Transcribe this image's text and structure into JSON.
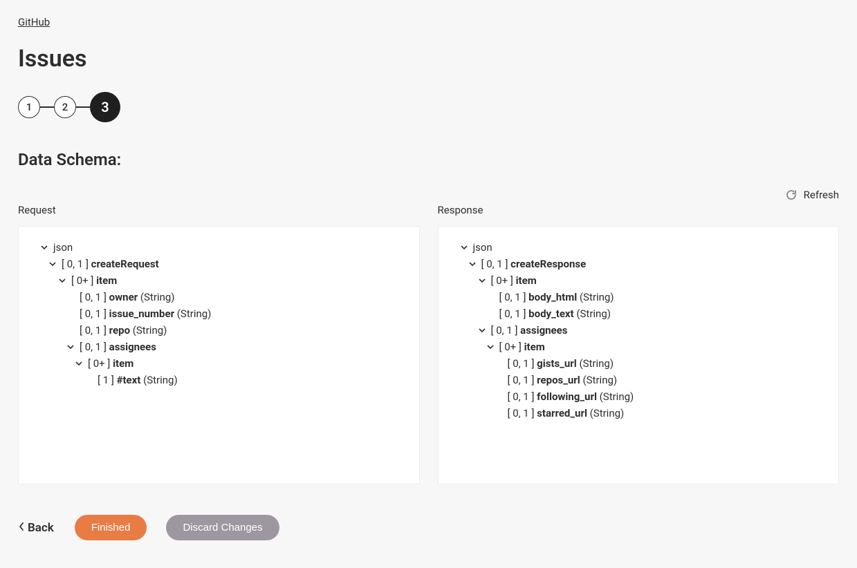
{
  "breadcrumb": {
    "label": "GitHub"
  },
  "page_title": "Issues",
  "stepper": {
    "steps": [
      "1",
      "2",
      "3"
    ],
    "active_index": 2
  },
  "section_title": "Data Schema:",
  "refresh_label": "Refresh",
  "columns": {
    "request": {
      "header": "Request",
      "root": "json",
      "tree": {
        "createRequest": {
          "card": "[ 0, 1 ]",
          "name": "createRequest"
        },
        "item": {
          "card": "[ 0+ ]",
          "name": "item"
        },
        "owner": {
          "card": "[ 0, 1 ]",
          "name": "owner",
          "type": "(String)"
        },
        "issue_number": {
          "card": "[ 0, 1 ]",
          "name": "issue_number",
          "type": "(String)"
        },
        "repo": {
          "card": "[ 0, 1 ]",
          "name": "repo",
          "type": "(String)"
        },
        "assignees": {
          "card": "[ 0, 1 ]",
          "name": "assignees"
        },
        "item2": {
          "card": "[ 0+ ]",
          "name": "item"
        },
        "text": {
          "card": "[ 1 ]",
          "name": "#text",
          "type": "(String)"
        }
      }
    },
    "response": {
      "header": "Response",
      "root": "json",
      "tree": {
        "createResponse": {
          "card": "[ 0, 1 ]",
          "name": "createResponse"
        },
        "item": {
          "card": "[ 0+ ]",
          "name": "item"
        },
        "body_html": {
          "card": "[ 0, 1 ]",
          "name": "body_html",
          "type": "(String)"
        },
        "body_text": {
          "card": "[ 0, 1 ]",
          "name": "body_text",
          "type": "(String)"
        },
        "assignees": {
          "card": "[ 0, 1 ]",
          "name": "assignees"
        },
        "item2": {
          "card": "[ 0+ ]",
          "name": "item"
        },
        "gists_url": {
          "card": "[ 0, 1 ]",
          "name": "gists_url",
          "type": "(String)"
        },
        "repos_url": {
          "card": "[ 0, 1 ]",
          "name": "repos_url",
          "type": "(String)"
        },
        "following_url": {
          "card": "[ 0, 1 ]",
          "name": "following_url",
          "type": "(String)"
        },
        "starred_url": {
          "card": "[ 0, 1 ]",
          "name": "starred_url",
          "type": "(String)"
        }
      }
    }
  },
  "footer": {
    "back": "Back",
    "finished": "Finished",
    "discard": "Discard Changes"
  }
}
